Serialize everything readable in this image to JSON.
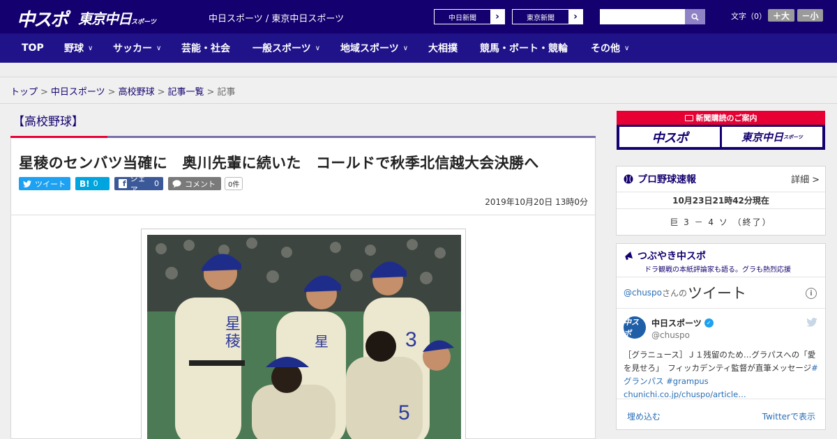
{
  "header": {
    "logo1": "中スポ",
    "logo2": "東京中日",
    "logo2_sub": "スポーツ",
    "site_link": "中日スポーツ / 東京中日スポーツ",
    "btn1": "中日新聞",
    "btn2": "東京新聞",
    "fontsize_label": "文字（0）",
    "font_plus": "＋大",
    "font_minus": "－小"
  },
  "nav": {
    "items": [
      {
        "label": "TOP"
      },
      {
        "label": "野球"
      },
      {
        "label": "サッカー"
      },
      {
        "label": "芸能・社会"
      },
      {
        "label": "一般スポーツ"
      },
      {
        "label": "地域スポーツ"
      },
      {
        "label": "大相撲"
      },
      {
        "label": "競馬・ボート・競輪"
      },
      {
        "label": "その他"
      }
    ]
  },
  "breadcrumb": {
    "items": [
      "トップ",
      "中日スポーツ",
      "高校野球",
      "記事一覧",
      "記事"
    ],
    "sep": ">"
  },
  "section_title": "【高校野球】",
  "article": {
    "headline": "星稜のセンバツ当確に　奥川先輩に続いた　コールドで秋季北信越大会決勝へ",
    "share": {
      "tweet": "ツイート",
      "hatena_label": "B!",
      "hatena_count": "0",
      "facebook_label": "シェア",
      "facebook_count": "0",
      "comment_label": "コメント",
      "comment_count": "0件"
    },
    "date": "2019年10月20日 13時0分"
  },
  "sidebar": {
    "ad": {
      "top": "新聞購読のご案内",
      "box1": "中スポ",
      "box2": "東京中日",
      "box2_sub": "スポーツ"
    },
    "baseball": {
      "title": "プロ野球速報",
      "detail": "詳細",
      "detail_arrow": ">",
      "time": "10月23日21時42分現在",
      "score": "巨 3 － 4 ソ （終了）"
    },
    "tsubuyaki": {
      "title": "つぶやき中スポ",
      "subtitle": "ドラ観戦の本紙評論家も語る。グラも熱烈応援",
      "handle": "@chuspo",
      "san": "さんの",
      "label": "ツイート",
      "info": "i",
      "avatar_text": "中スポ",
      "name": "中日スポーツ",
      "user": "@chuspo",
      "text_1": "［グラニュース］Ｊ１残留のため…グラパスへの「愛を見せろ」　フィッカデンティ監督が直筆メッセージ",
      "tag1": "#グランパス",
      "tag2": "#grampus",
      "link": "chunichi.co.jp/chuspo/article…",
      "embed": "埋め込む",
      "view": "Twitterで表示"
    }
  },
  "colors": {
    "header": "#14006e",
    "nav": "#20138a",
    "accent_red": "#e60033",
    "link": "#2a6eb5"
  }
}
